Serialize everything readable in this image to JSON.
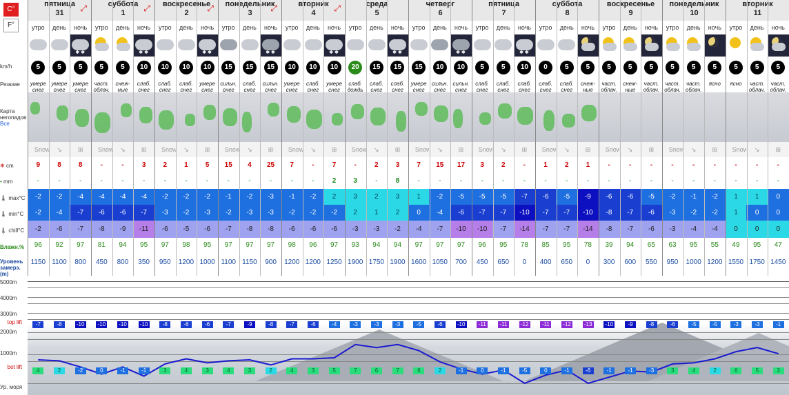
{
  "units": {
    "celsius": "C°",
    "fahrenheit": "F°"
  },
  "labels": {
    "wind": "km/h",
    "summary": "Резюме",
    "map": "Карта негопадов",
    "map_all": "Все",
    "snow": "cm",
    "rain": "mm",
    "tmax": "max°C",
    "tmin": "min°C",
    "chill": "chill°C",
    "humidity": "Влажн.%",
    "freezing": "Уровень замерз. (m)",
    "alt5000": "5000m",
    "alt4000": "4000m",
    "alt3000": "3000m",
    "alt2000": "2000m",
    "alt1000": "1000m",
    "toplift": "top lift",
    "botlift": "bot lift",
    "sea": "Ур. моря"
  },
  "watermark": "Snow-Forecast.com",
  "days": [
    {
      "name": "пятница",
      "date": "31",
      "arrow": true
    },
    {
      "name": "суббота",
      "date": "1",
      "arrow": true
    },
    {
      "name": "воскресенье",
      "date": "2",
      "arrow": true
    },
    {
      "name": "понедельник",
      "date": "3",
      "arrow": true
    },
    {
      "name": "вторник",
      "date": "4",
      "arrow": true
    },
    {
      "name": "среда",
      "date": "5",
      "arrow": false
    },
    {
      "name": "четверг",
      "date": "6",
      "arrow": false
    },
    {
      "name": "пятница",
      "date": "7",
      "arrow": false
    },
    {
      "name": "суббота",
      "date": "8",
      "arrow": false
    },
    {
      "name": "воскресенье",
      "date": "9",
      "arrow": false
    },
    {
      "name": "понедельник",
      "date": "10",
      "arrow": false
    },
    {
      "name": "вторник",
      "date": "11",
      "arrow": false
    }
  ],
  "tod": [
    "утро",
    "день",
    "ночь"
  ],
  "wind": [
    "5",
    "5",
    "5",
    "5",
    "5",
    "10",
    "10",
    "10",
    "10",
    "15",
    "15",
    "15",
    "10",
    "10",
    "10",
    "20",
    "15",
    "15",
    "15",
    "10",
    "10",
    "5",
    "5",
    "10",
    "0",
    "5",
    "5",
    "5",
    "5",
    "5",
    "5",
    "5",
    "5",
    "5",
    "5",
    "5"
  ],
  "summary": [
    "умере снег",
    "умере снег",
    "умере снег",
    "част. облач.",
    "снеж- ные",
    "слаб. снег",
    "слаб. снег",
    "слаб. снег",
    "умере снег",
    "сильн. снег",
    "слаб. снег",
    "сильн. снег",
    "умере снег",
    "слаб. снег",
    "умере снег",
    "слаб. дождь",
    "слаб. снег",
    "слаб. снег",
    "умере снег",
    "сильн. снег",
    "сильн. снег",
    "слаб. снег",
    "слаб. снег",
    "слаб. снег",
    "слаб. снег",
    "слаб. снег",
    "снеж- ные",
    "част. облач.",
    "снеж- ные",
    "част. облач.",
    "част. облач.",
    "част. облач.",
    "ясно",
    "ясно",
    "част. облач.",
    "част. облач."
  ],
  "snow": [
    "9",
    "8",
    "8",
    "-",
    "-",
    "3",
    "2",
    "1",
    "5",
    "15",
    "4",
    "25",
    "7",
    "-",
    "7",
    "-",
    "2",
    "3",
    "7",
    "15",
    "17",
    "3",
    "2",
    "-",
    "1",
    "2",
    "1",
    "-",
    "-",
    "-",
    "-",
    "-",
    "-",
    "-",
    "-",
    "-"
  ],
  "rain": [
    "-",
    "-",
    "-",
    "-",
    "-",
    "-",
    "-",
    "-",
    "-",
    "-",
    "-",
    "-",
    "-",
    "-",
    "2",
    "3",
    "-",
    "8",
    "-",
    "-",
    "-",
    "-",
    "-",
    "-",
    "-",
    "-",
    "-",
    "-",
    "-",
    "-",
    "-",
    "-",
    "-",
    "-",
    "-",
    "-"
  ],
  "tmax": [
    "-2",
    "-2",
    "-4",
    "-4",
    "-4",
    "-4",
    "-2",
    "-2",
    "-2",
    "-1",
    "-2",
    "-3",
    "-1",
    "-2",
    "2",
    "3",
    "2",
    "3",
    "1",
    "-2",
    "-5",
    "-5",
    "-5",
    "-7",
    "-6",
    "-5",
    "-9",
    "-6",
    "-6",
    "-5",
    "-2",
    "-1",
    "-2",
    "1",
    "1",
    "0"
  ],
  "tmin": [
    "-2",
    "-4",
    "-7",
    "-6",
    "-6",
    "-7",
    "-3",
    "-2",
    "-3",
    "-2",
    "-3",
    "-3",
    "-2",
    "-2",
    "-2",
    "2",
    "1",
    "2",
    "0",
    "-4",
    "-6",
    "-7",
    "-7",
    "-10",
    "-7",
    "-7",
    "-10",
    "-8",
    "-7",
    "-6",
    "-3",
    "-2",
    "-2",
    "1",
    "0",
    "0"
  ],
  "chill": [
    "-2",
    "-6",
    "-7",
    "-8",
    "-9",
    "-11",
    "-6",
    "-5",
    "-6",
    "-7",
    "-8",
    "-8",
    "-6",
    "-6",
    "-6",
    "-3",
    "-3",
    "-2",
    "-4",
    "-7",
    "-10",
    "-10",
    "-7",
    "-14",
    "-7",
    "-7",
    "-14",
    "-8",
    "-7",
    "-6",
    "-3",
    "-4",
    "-4",
    "0",
    "0",
    "0"
  ],
  "humidity": [
    "96",
    "92",
    "97",
    "81",
    "94",
    "95",
    "97",
    "98",
    "95",
    "97",
    "97",
    "97",
    "98",
    "96",
    "97",
    "93",
    "94",
    "94",
    "97",
    "97",
    "97",
    "96",
    "95",
    "78",
    "85",
    "95",
    "78",
    "39",
    "94",
    "65",
    "63",
    "95",
    "55",
    "49",
    "95",
    "47"
  ],
  "freezing": [
    "1150",
    "1100",
    "800",
    "450",
    "800",
    "350",
    "950",
    "1200",
    "1000",
    "1100",
    "1150",
    "900",
    "1200",
    "1200",
    "1250",
    "1900",
    "1750",
    "1900",
    "1600",
    "1050",
    "700",
    "450",
    "650",
    "0",
    "400",
    "650",
    "0",
    "300",
    "600",
    "550",
    "950",
    "1000",
    "1200",
    "1550",
    "1750",
    "1450"
  ],
  "toplift": [
    "-7",
    "-8",
    "-10",
    "-10",
    "-10",
    "-10",
    "-8",
    "-6",
    "-6",
    "-7",
    "-9",
    "-8",
    "-7",
    "-6",
    "-4",
    "-3",
    "-3",
    "-3",
    "-5",
    "-6",
    "-10",
    "-11",
    "-11",
    "-12",
    "-11",
    "-12",
    "-13",
    "-10",
    "-9",
    "-8",
    "-6",
    "-5",
    "-5",
    "-3",
    "-3",
    "-1"
  ],
  "botlift": [
    "4",
    "2",
    "-2",
    "0",
    "-1",
    "-1",
    "3",
    "4",
    "3",
    "4",
    "3",
    "2",
    "4",
    "3",
    "5",
    "7",
    "6",
    "7",
    "6",
    "2",
    "-1",
    "0",
    "-1",
    "-5",
    "0",
    "-1",
    "-6",
    "-1",
    "-1",
    "-3",
    "3",
    "4",
    "2",
    "6",
    "5",
    "3"
  ],
  "colors": {
    "warm": "#2bd9e6",
    "cold1": "#1e6fe0",
    "cold2": "#1a3fd0",
    "cold3": "#0d10c0",
    "chill": "#9fa3ef",
    "chillDeep": "#b57ee8",
    "line": "#1a1ad0",
    "green": "#2a8a1a"
  }
}
